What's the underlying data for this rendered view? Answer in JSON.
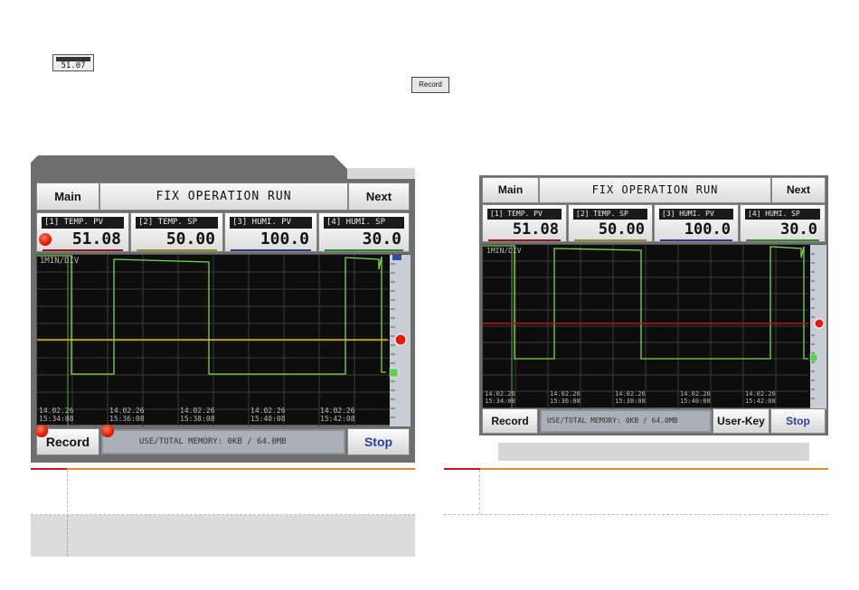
{
  "mini_tile": {
    "value": "51.07"
  },
  "mini_record": {
    "label": "Record"
  },
  "left": {
    "header": {
      "main": "Main",
      "title": "FIX OPERATION RUN",
      "next": "Next"
    },
    "tiles": [
      {
        "label": "[1] TEMP. PV",
        "value": "51.08",
        "bar_color": "#8b1a1a"
      },
      {
        "label": "[2] TEMP. SP",
        "value": "50.00",
        "bar_color": "#9a8a2a"
      },
      {
        "label": "[3] HUMI. PV",
        "value": "100.0",
        "bar_color": "#2a3a8a"
      },
      {
        "label": "[4] HUMI. SP",
        "value": "30.0",
        "bar_color": "#2a8a2a"
      }
    ],
    "chart": {
      "div_label": "1MIN/DIV",
      "x_ticks": [
        [
          "14.02.26",
          "15:34:08"
        ],
        [
          "14.02.26",
          "15:36:08"
        ],
        [
          "14.02.26",
          "15:38:08"
        ],
        [
          "14.02.26",
          "15:40:08"
        ],
        [
          "14.02.26",
          "15:42:08"
        ]
      ]
    },
    "footer": {
      "record": "Record",
      "memory": "USE/TOTAL MEMORY:   0KB /  64.0MB",
      "stop": "Stop"
    }
  },
  "right": {
    "header": {
      "main": "Main",
      "title": "FIX OPERATION RUN",
      "next": "Next"
    },
    "tiles": [
      {
        "label": "[1] TEMP. PV",
        "value": "51.08",
        "bar_color": "#8b1a1a"
      },
      {
        "label": "[2] TEMP. SP",
        "value": "50.00",
        "bar_color": "#9a8a2a"
      },
      {
        "label": "[3] HUMI. PV",
        "value": "100.0",
        "bar_color": "#2a3a8a"
      },
      {
        "label": "[4] HUMI. SP",
        "value": "30.0",
        "bar_color": "#2a8a2a"
      }
    ],
    "chart": {
      "div_label": "1MIN/DIV",
      "x_ticks": [
        [
          "14.02.26",
          "15:34:08"
        ],
        [
          "14.02.26",
          "15:36:08"
        ],
        [
          "14.02.26",
          "15:38:08"
        ],
        [
          "14.02.26",
          "15:40:08"
        ],
        [
          "14.02.26",
          "15:42:08"
        ]
      ]
    },
    "footer": {
      "record": "Record",
      "memory": "USE/TOTAL MEMORY:   0KB /  64.0MB",
      "userkey": "User-Key",
      "stop": "Stop"
    }
  },
  "colors": {
    "accent_orange": "#e88a1e",
    "accent_red": "#c8122a",
    "indicator_red": "#e21a00",
    "trend_yellow": "#e8b21a",
    "trend_green": "#7ed64a",
    "trend_red": "#c0141e"
  }
}
